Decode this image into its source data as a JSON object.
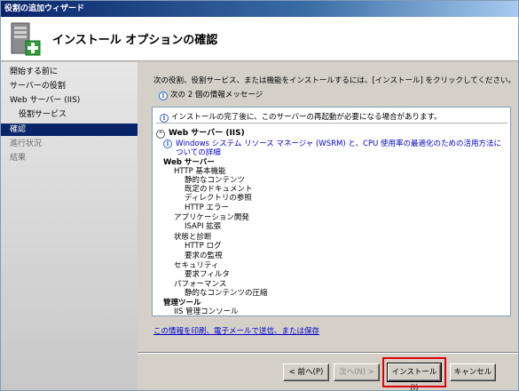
{
  "window": {
    "title": "役割の追加ウィザード"
  },
  "header": {
    "title": "インストール オプションの確認"
  },
  "sidebar": {
    "items": [
      {
        "label": "開始する前に"
      },
      {
        "label": "サーバーの役割"
      },
      {
        "label": "Web サーバー (IIS)"
      },
      {
        "label": "役割サービス"
      },
      {
        "label": "確認"
      },
      {
        "label": "進行状況"
      },
      {
        "label": "結果"
      }
    ]
  },
  "main": {
    "intro": "次の役割、役割サービス、または機能をインストールするには、[インストール] をクリックしてください。",
    "message_count": "次の 2 個の情報メッセージ",
    "restart_note": "インストールの完了後に、このサーバーの再起動が必要になる場合があります。",
    "section_title": "Web サーバー (IIS)",
    "wsrm_link": "Windows システム リソース マネージャ (WSRM) と、CPU 使用率の最適化のための活用方法についての詳細",
    "tree": [
      {
        "label": "Web サーバー",
        "level": 0,
        "bold": true
      },
      {
        "label": "HTTP 基本機能",
        "level": 1
      },
      {
        "label": "静的なコンテンツ",
        "level": 2
      },
      {
        "label": "既定のドキュメント",
        "level": 2
      },
      {
        "label": "ディレクトリの参照",
        "level": 2
      },
      {
        "label": "HTTP エラー",
        "level": 2
      },
      {
        "label": "アプリケーション開発",
        "level": 1
      },
      {
        "label": "ISAPI 拡張",
        "level": 2
      },
      {
        "label": "状態と診断",
        "level": 1
      },
      {
        "label": "HTTP ログ",
        "level": 2
      },
      {
        "label": "要求の監視",
        "level": 2
      },
      {
        "label": "セキュリティ",
        "level": 1
      },
      {
        "label": "要求フィルタ",
        "level": 2
      },
      {
        "label": "パフォーマンス",
        "level": 1
      },
      {
        "label": "静的なコンテンツの圧縮",
        "level": 2
      },
      {
        "label": "管理ツール",
        "level": 0,
        "bold": true
      },
      {
        "label": "IIS 管理コンソール",
        "level": 1
      }
    ],
    "print_link": "この情報を印刷、電子メールで送信、または保存"
  },
  "footer": {
    "back_label": "< 前へ(P)",
    "next_label": "次へ(N) >",
    "install_label": "インストール(I)",
    "cancel_label": "キャンセル"
  },
  "colors": {
    "selected": "#0a246a",
    "link": "#0000cc",
    "highlight": "#e00000"
  }
}
